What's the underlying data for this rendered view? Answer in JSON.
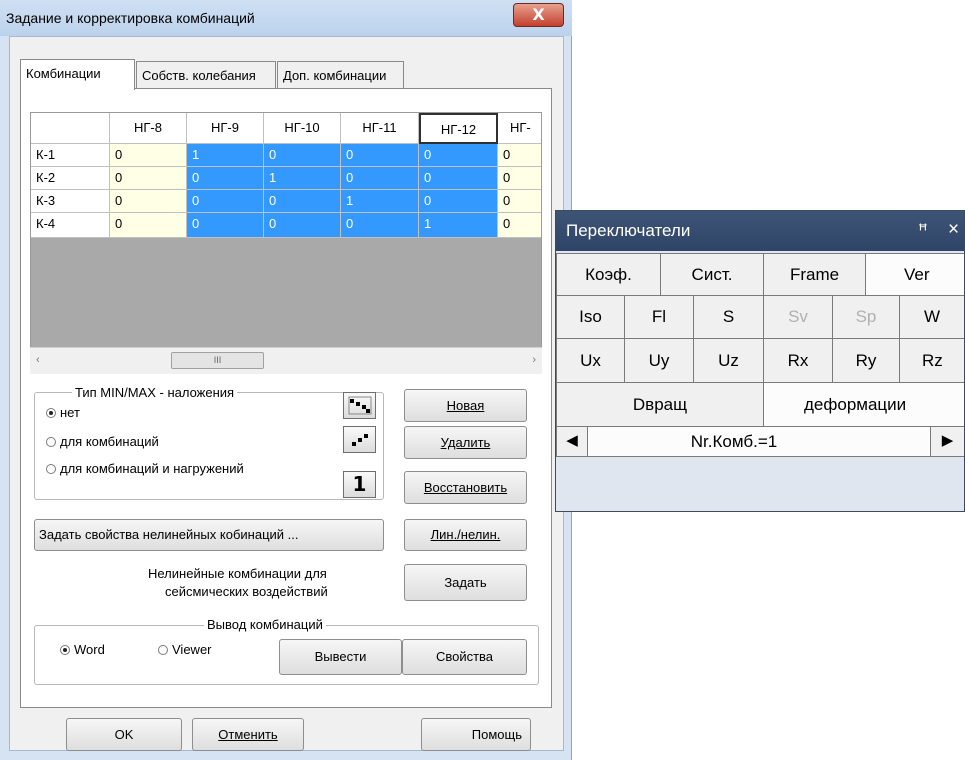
{
  "window": {
    "title": "Задание и корректировка комбинаций",
    "close_glyph": "X"
  },
  "tabs": [
    {
      "label": "Комбинации",
      "active": true
    },
    {
      "label": "Собств. колебания",
      "active": false
    },
    {
      "label": "Доп. комбинации",
      "active": false
    }
  ],
  "grid": {
    "columns": [
      "НГ-8",
      "НГ-9",
      "НГ-10",
      "НГ-11",
      "НГ-12",
      "НГ-"
    ],
    "rows": [
      {
        "name": "К-1",
        "cells": [
          "0",
          "1",
          "0",
          "0",
          "0",
          "0"
        ]
      },
      {
        "name": "К-2",
        "cells": [
          "0",
          "0",
          "1",
          "0",
          "0",
          "0"
        ]
      },
      {
        "name": "К-3",
        "cells": [
          "0",
          "0",
          "0",
          "1",
          "0",
          "0"
        ]
      },
      {
        "name": "К-4",
        "cells": [
          "0",
          "0",
          "0",
          "0",
          "1",
          "0"
        ]
      }
    ],
    "scroll_left": "‹",
    "scroll_right": "›",
    "scroll_thumb": "III"
  },
  "minmax_group": {
    "legend": "Тип  MIN/MAX - наложения",
    "options": [
      {
        "label": "нет",
        "selected": true
      },
      {
        "label": "для комбинаций",
        "selected": false
      },
      {
        "label": "для комбинаций и нагружений",
        "selected": false
      }
    ]
  },
  "icon_buttons": {
    "btn3_label": "1"
  },
  "buttons": {
    "new": "Новая",
    "delete": "Удалить",
    "restore": "Восстановить",
    "nonlinear_props": "Задать свойства нелинейных кобинаций ...",
    "lin_nonlin": "Лин./нелин.",
    "set": "Задать",
    "export": "Вывести",
    "properties": "Свойства",
    "ok": "OK",
    "cancel": "Отменить",
    "help": "Помощь"
  },
  "seismic_label_1": "Нелинейные комбинации для",
  "seismic_label_2": "сейсмических воздействий",
  "output_group": {
    "legend": "Вывод  комбинаций",
    "options": [
      {
        "label": "Word",
        "selected": true
      },
      {
        "label": "Viewer",
        "selected": false
      }
    ]
  },
  "switches_panel": {
    "title": "Переключатели",
    "pin_glyph": "ꟸ",
    "close_glyph": "×",
    "row1": [
      "Коэф.",
      "Сист.",
      "Frame",
      "Ver"
    ],
    "row2": [
      "Iso",
      "Fl",
      "S",
      "Sv",
      "Sp",
      "W"
    ],
    "row3": [
      "Ux",
      "Uy",
      "Uz",
      "Rx",
      "Ry",
      "Rz"
    ],
    "row4": [
      "Dвращ",
      "деформации"
    ],
    "nav_left": "◀",
    "nav_right": "▶",
    "nav_label": "Nr.Комб.=1"
  }
}
